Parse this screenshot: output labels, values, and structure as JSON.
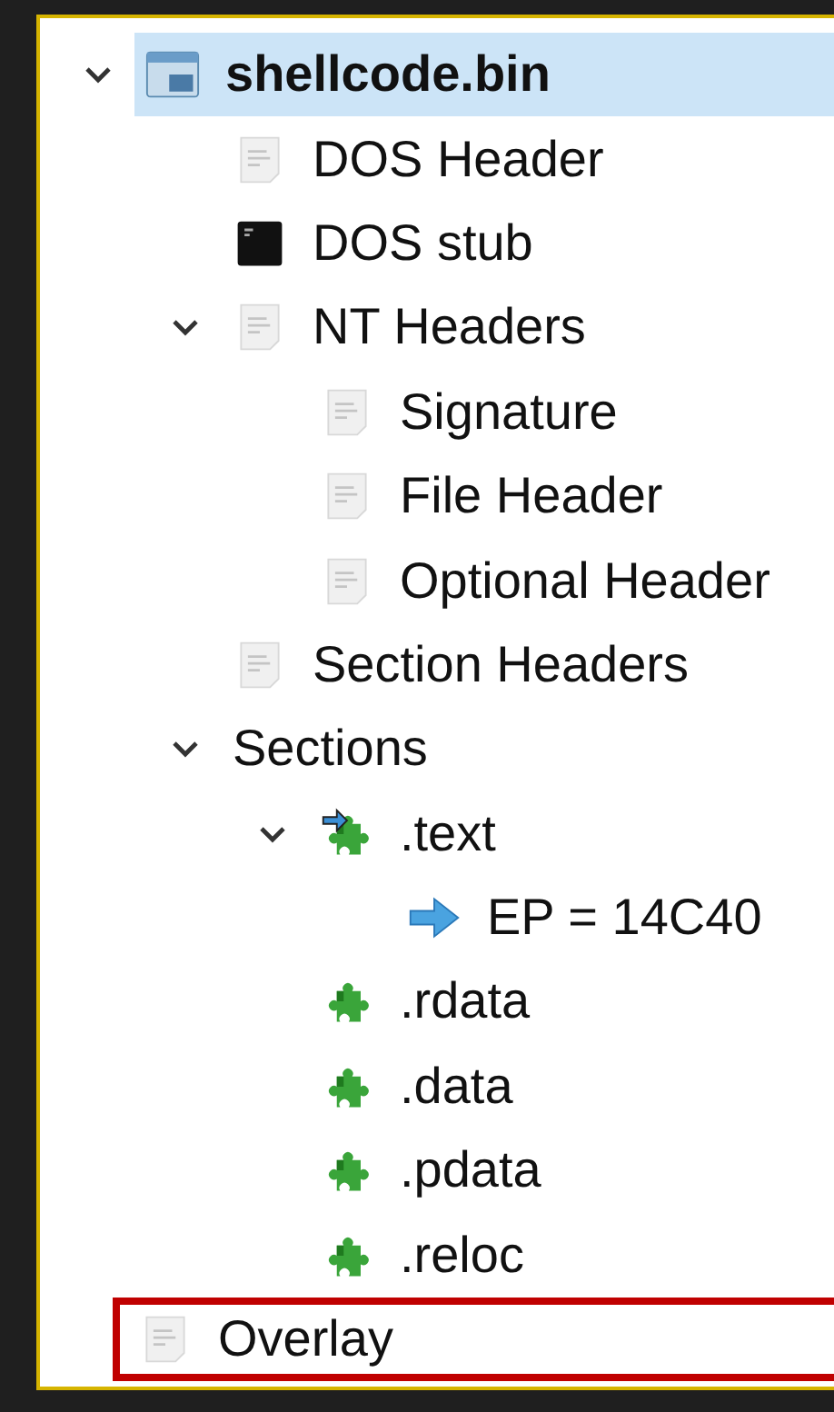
{
  "tree": [
    {
      "label": "shellcode.bin",
      "kind": "app64",
      "selected": true,
      "outlined": false,
      "expanded": true,
      "children": [
        {
          "label": "DOS Header",
          "kind": "doc",
          "selected": false,
          "outlined": false
        },
        {
          "label": "DOS stub",
          "kind": "console",
          "selected": false,
          "outlined": false
        },
        {
          "label": "NT Headers",
          "kind": "doc",
          "selected": false,
          "outlined": false,
          "expanded": true,
          "children": [
            {
              "label": "Signature",
              "kind": "doc",
              "selected": false,
              "outlined": false
            },
            {
              "label": "File Header",
              "kind": "doc",
              "selected": false,
              "outlined": false
            },
            {
              "label": "Optional Header",
              "kind": "doc",
              "selected": false,
              "outlined": false
            }
          ]
        },
        {
          "label": "Section Headers",
          "kind": "doc",
          "selected": false,
          "outlined": false
        },
        {
          "label": "Sections",
          "kind": "none",
          "selected": false,
          "outlined": false,
          "expanded": true,
          "children": [
            {
              "label": ".text",
              "kind": "section-ep",
              "selected": false,
              "outlined": false,
              "expanded": true,
              "children": [
                {
                  "label": "EP = 14C40",
                  "kind": "arrow",
                  "selected": false,
                  "outlined": false
                }
              ]
            },
            {
              "label": ".rdata",
              "kind": "section",
              "selected": false,
              "outlined": false
            },
            {
              "label": ".data",
              "kind": "section",
              "selected": false,
              "outlined": false
            },
            {
              "label": ".pdata",
              "kind": "section",
              "selected": false,
              "outlined": false
            },
            {
              "label": ".reloc",
              "kind": "section",
              "selected": false,
              "outlined": false
            }
          ]
        }
      ]
    },
    {
      "label": "Overlay",
      "kind": "doc",
      "selected": false,
      "outlined": true
    }
  ]
}
